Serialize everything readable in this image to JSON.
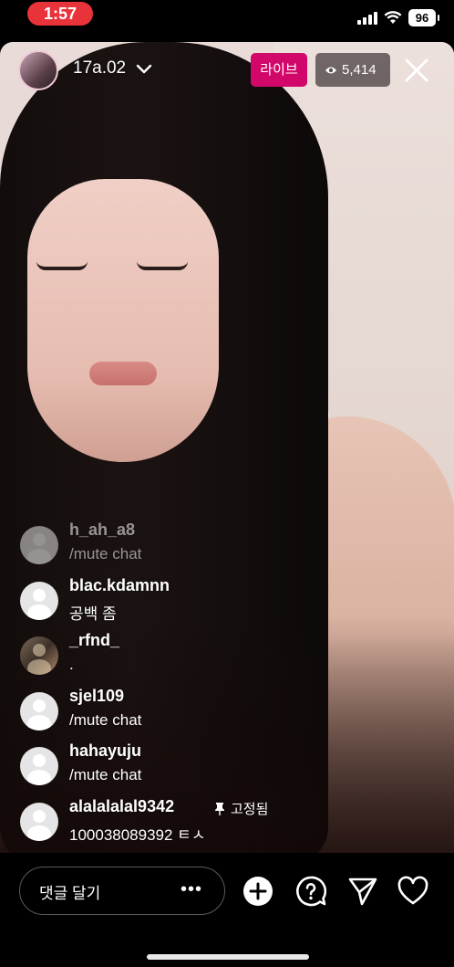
{
  "status_bar": {
    "time": "1:57",
    "battery": "96"
  },
  "header": {
    "username": "17a.02",
    "live_label": "라이브",
    "viewer_count": "5,414"
  },
  "comments": [
    {
      "username": "h_ah_a8",
      "text": "/mute chat"
    },
    {
      "username": "blac.kdamnn",
      "text": "공백 좀"
    },
    {
      "username": "_rfnd_",
      "text": "."
    },
    {
      "username": "sjel109",
      "text": "/mute chat"
    },
    {
      "username": "hahayuju",
      "text": "/mute chat"
    },
    {
      "username": "alalalalal9342",
      "text": "100038089392 ㅌㅅ",
      "pinned_label": "고정됨"
    }
  ],
  "bottom_bar": {
    "comment_placeholder": "댓글 달기",
    "more_label": "•••"
  },
  "icons": [
    "eye-icon",
    "chevron-down-icon",
    "close-icon",
    "add-icon",
    "question-icon",
    "send-icon",
    "heart-icon",
    "pin-icon"
  ]
}
